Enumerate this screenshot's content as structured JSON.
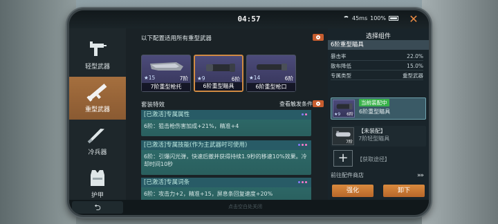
{
  "header": {
    "clock": "04:57",
    "ping": "45ms",
    "battery": "100%",
    "close_glyph": "✕"
  },
  "sidebar": {
    "items": [
      {
        "label": "轻型武器",
        "icon": "smg-icon",
        "active": false
      },
      {
        "label": "重型武器",
        "icon": "rocket-launcher-icon",
        "active": true
      },
      {
        "label": "冷兵器",
        "icon": "knife-icon",
        "active": false
      },
      {
        "label": "护甲",
        "icon": "armor-vest-icon",
        "active": false
      }
    ]
  },
  "main": {
    "config_title": "以下配置适用所有重型武器",
    "slots": [
      {
        "name": "7阶重型枪托",
        "level": "15",
        "tier": "7阶",
        "selected": false
      },
      {
        "name": "6阶重型瞄具",
        "level": "9",
        "tier": "6阶",
        "selected": true
      },
      {
        "name": "6阶重型枪口",
        "level": "14",
        "tier": "6阶",
        "selected": false
      }
    ],
    "set_title": "套装特效",
    "trigger_link": "查看触发条件",
    "effects": [
      {
        "header": "[已激活]专属属性",
        "body": "6阶：狙击枪伤害加成+21%，精准+4"
      },
      {
        "header": "[已激活]专属技能(作为主武器时可使用)",
        "body": "6阶：引爆闪光弹，快速后撤并获得持续1.9秒的移速10%效果。冷却时间10秒"
      },
      {
        "header": "[已激活]专属词条",
        "body": "6阶：攻击力+2，精准+15，屏息条回复速度+20%"
      }
    ]
  },
  "panel": {
    "title": "选择组件",
    "head": "6阶重型瞄具",
    "stats": [
      {
        "label": "暴击率",
        "value": "22.0%"
      },
      {
        "label": "散布降低",
        "value": "15.0%"
      },
      {
        "label": "专属类型",
        "value": "重型武器"
      }
    ],
    "current": {
      "badge": "当前装配中",
      "name": "6阶重型瞄具",
      "level": "9",
      "tier": "6阶"
    },
    "other": {
      "status": "【未装配】",
      "name": "7阶轻型瞄具",
      "level": "",
      "tier": "7阶"
    },
    "get_route": "【获取途径】",
    "shop_link": "前往配件商店",
    "shop_arrows": "»»",
    "btn_upgrade": "强化",
    "btn_unequip": "卸下"
  },
  "footer": {
    "back_glyph": "⮌",
    "hint": "点击空白处关闭"
  },
  "colors": {
    "accent": "#d18b43",
    "active_tab": "#a56f3e",
    "effect_card": "#2e6c6b",
    "equipped_badge": "#39b24a",
    "close": "#e88b45"
  }
}
